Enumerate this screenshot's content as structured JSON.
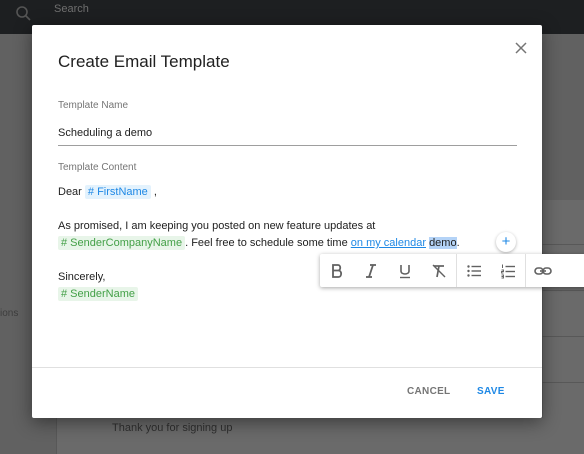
{
  "background": {
    "search_placeholder": "Search",
    "left_label": "ions",
    "bottom_item": "Thank you for signing up"
  },
  "dialog": {
    "title": "Create Email Template",
    "close_icon": "close-icon",
    "template_name_label": "Template Name",
    "template_name_value": "Scheduling a demo",
    "template_content_label": "Template Content",
    "content": {
      "line1_prefix": "Dear",
      "line1_tag": "# FirstName",
      "line1_suffix": ",",
      "line2": "As promised, I am keeping you posted on new feature updates at",
      "line3_tag": "# SenderCompanyName",
      "line3_text": ". Feel free to schedule some time",
      "line3_link": "on my calendar",
      "line3_selected": "demo",
      "line3_end": ".",
      "line4": "Sincerely,",
      "line5_tag": "# SenderName"
    },
    "plus_label": "+",
    "toolbar": [
      "bold-icon",
      "italic-icon",
      "underline-icon",
      "clear-format-icon",
      "bulleted-list-icon",
      "numbered-list-icon",
      "link-icon"
    ],
    "cancel_label": "CANCEL",
    "save_label": "SAVE",
    "colors": {
      "accent": "#1e88e5",
      "tag_blue_bg": "#e3f2fd",
      "tag_green_bg": "#e8f5e9",
      "tag_green_text": "#43a047",
      "selection": "#b4d3f7"
    }
  }
}
